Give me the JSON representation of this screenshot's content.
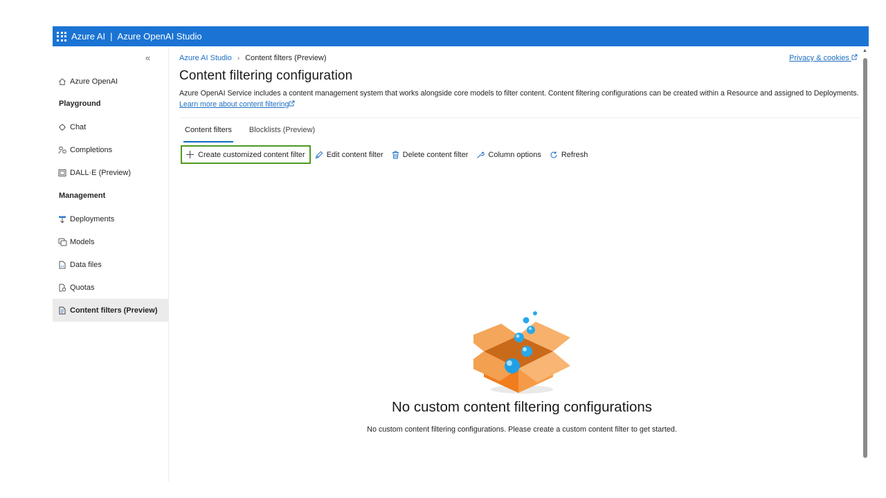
{
  "topbar": {
    "brand": "Azure AI",
    "separator": "|",
    "product": "Azure OpenAI Studio"
  },
  "sidebar": {
    "collapse_glyph": "«",
    "items": [
      {
        "label": "Azure OpenAI",
        "icon": "home-icon"
      },
      {
        "label": "Playground",
        "type": "header"
      },
      {
        "label": "Chat",
        "icon": "chat-icon"
      },
      {
        "label": "Completions",
        "icon": "completions-icon"
      },
      {
        "label": "DALL·E (Preview)",
        "icon": "image-icon"
      },
      {
        "label": "Management",
        "type": "header"
      },
      {
        "label": "Deployments",
        "icon": "deployments-icon"
      },
      {
        "label": "Models",
        "icon": "models-icon"
      },
      {
        "label": "Data files",
        "icon": "data-files-icon"
      },
      {
        "label": "Quotas",
        "icon": "quotas-icon"
      },
      {
        "label": "Content filters (Preview)",
        "icon": "content-filters-icon",
        "active": true
      }
    ]
  },
  "breadcrumb": {
    "root": "Azure AI Studio",
    "current": "Content filters (Preview)"
  },
  "privacy_link": "Privacy & cookies",
  "page": {
    "title": "Content filtering configuration",
    "description": "Azure OpenAI Service includes a content management system that works alongside core models to filter content. Content filtering configurations can be created within a Resource and assigned to Deployments.",
    "learn_more": "Learn more about content filtering"
  },
  "tabs": [
    {
      "label": "Content filters",
      "selected": true
    },
    {
      "label": "Blocklists (Preview)",
      "selected": false
    }
  ],
  "toolbar": {
    "create": "Create customized content filter",
    "edit": "Edit content filter",
    "delete": "Delete content filter",
    "columns": "Column options",
    "refresh": "Refresh"
  },
  "empty": {
    "title": "No custom content filtering configurations",
    "subtitle": "No custom content filtering configurations. Please create a custom content filter to get started."
  },
  "colors": {
    "brand": "#1b74d4",
    "link": "#1b6ec2",
    "highlight_border": "#4e9a1e",
    "box": "#f0913a"
  }
}
